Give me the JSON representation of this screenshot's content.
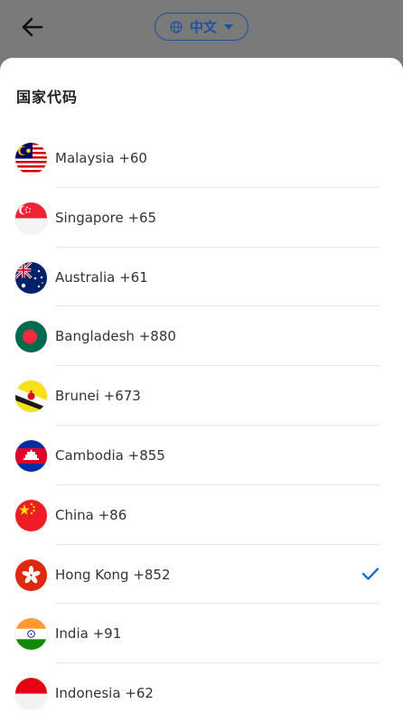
{
  "header": {
    "language_label": "中文",
    "back_icon": "arrow-left-icon",
    "globe_icon": "globe-icon",
    "caret_icon": "caret-down-icon"
  },
  "sheet": {
    "title": "国家代码"
  },
  "countries": [
    {
      "label": "Malaysia +60",
      "flag": "malaysia-flag-icon",
      "selected": false
    },
    {
      "label": "Singapore +65",
      "flag": "singapore-flag-icon",
      "selected": false
    },
    {
      "label": "Australia +61",
      "flag": "australia-flag-icon",
      "selected": false
    },
    {
      "label": "Bangladesh +880",
      "flag": "bangladesh-flag-icon",
      "selected": false
    },
    {
      "label": "Brunei +673",
      "flag": "brunei-flag-icon",
      "selected": false
    },
    {
      "label": "Cambodia +855",
      "flag": "cambodia-flag-icon",
      "selected": false
    },
    {
      "label": "China +86",
      "flag": "china-flag-icon",
      "selected": false
    },
    {
      "label": "Hong Kong +852",
      "flag": "hong-kong-flag-icon",
      "selected": true
    },
    {
      "label": "India +91",
      "flag": "india-flag-icon",
      "selected": false
    },
    {
      "label": "Indonesia +62",
      "flag": "indonesia-flag-icon",
      "selected": false
    }
  ],
  "colors": {
    "accent": "#1f6fd6",
    "overlay": "#7a7a7a",
    "pill_border": "#1f4fa0"
  }
}
